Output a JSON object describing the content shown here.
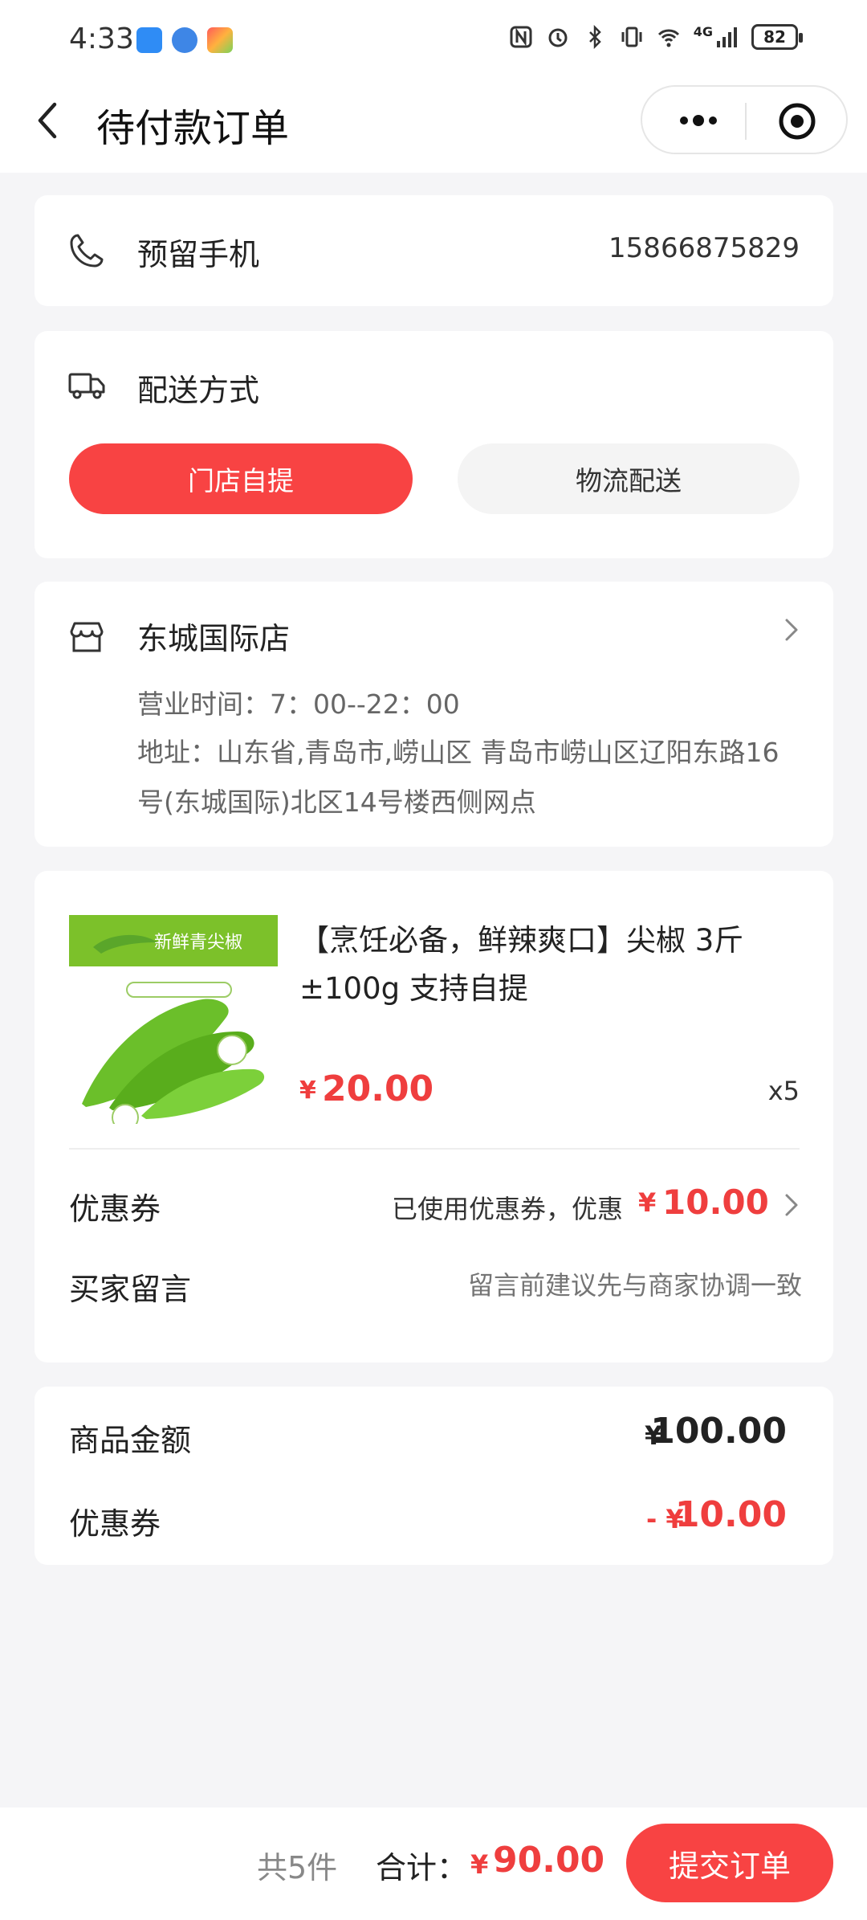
{
  "status_bar": {
    "time": "4:33",
    "network": "4G",
    "battery": "82"
  },
  "nav": {
    "title": "待付款订单"
  },
  "phone": {
    "label": "预留手机",
    "value": "15866875829"
  },
  "delivery": {
    "label": "配送方式",
    "options": [
      "门店自提",
      "物流配送"
    ],
    "selected": "门店自提"
  },
  "store": {
    "name": "东城国际店",
    "hours": "营业时间：7：00--22：00",
    "address_line1": "地址：山东省,青岛市,崂山区 青岛市崂山区辽阳东路16",
    "address_line2": "号(东城国际)北区14号楼西侧网点"
  },
  "product": {
    "image_banner": "新鲜青尖椒",
    "title_line1": "【烹饪必备，鲜辣爽口】尖椒 3斤",
    "title_line2": "±100g 支持自提",
    "currency": "¥",
    "price": "20.00",
    "quantity": "x5"
  },
  "coupon": {
    "label": "优惠券",
    "desc": "已使用优惠券，优惠",
    "currency": "¥",
    "amount": "10.00"
  },
  "message": {
    "label": "买家留言",
    "placeholder": "留言前建议先与商家协调一致"
  },
  "summary": {
    "goods_label": "商品金额",
    "goods_currency": "¥",
    "goods_amount": "100.00",
    "coupon_label": "优惠券",
    "coupon_prefix": "- ¥",
    "coupon_amount": "10.00"
  },
  "footer": {
    "count": "共5件",
    "total_label": "合计：",
    "currency": "¥",
    "total": "90.00",
    "submit": "提交订单"
  },
  "colors": {
    "accent": "#f84343",
    "price": "#ef3e3e",
    "background": "#f5f5f7"
  }
}
